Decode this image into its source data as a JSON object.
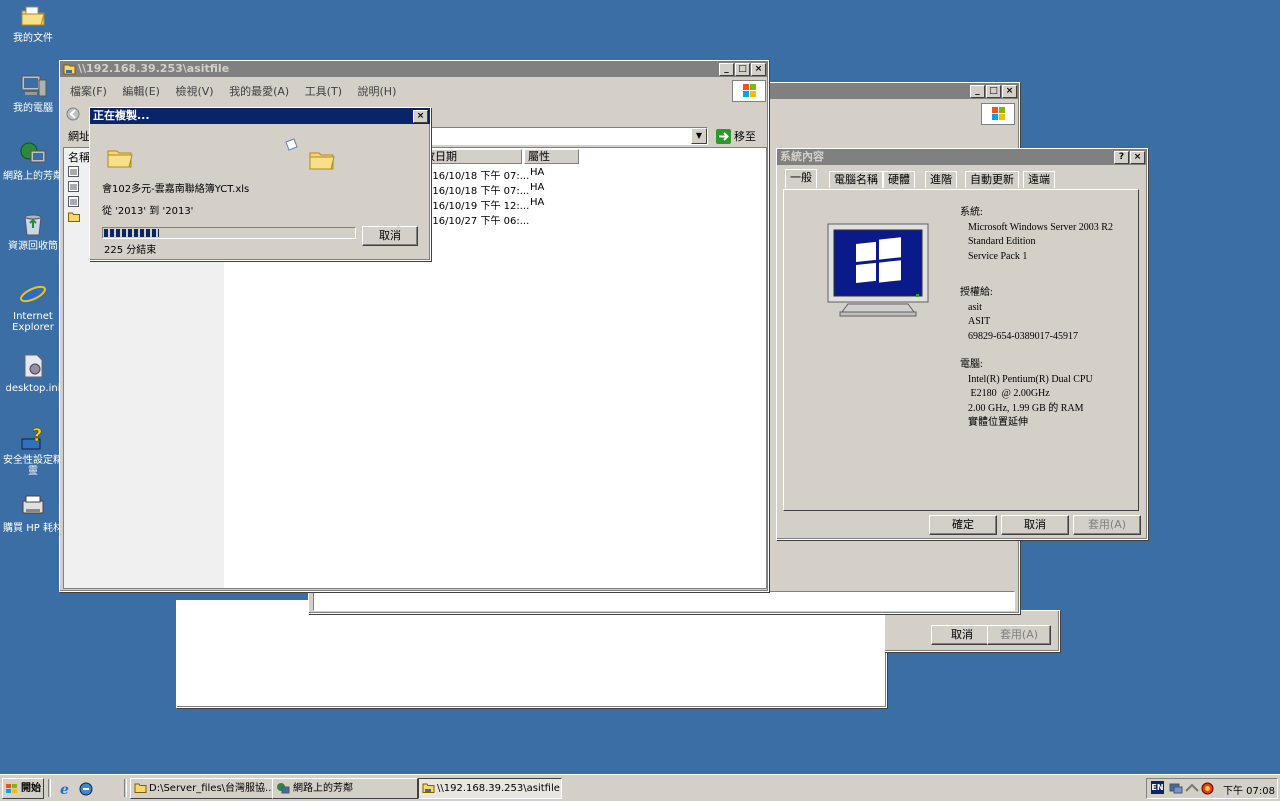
{
  "desktop": {
    "icons": [
      {
        "label": "我的文件",
        "icon": "folder-icon"
      },
      {
        "label": "我的電腦",
        "icon": "computer-icon"
      },
      {
        "label": "網路上的芳鄰",
        "icon": "network-icon"
      },
      {
        "label": "資源回收筒",
        "icon": "recycle-bin-icon"
      },
      {
        "label": "Internet Explorer",
        "icon": "ie-icon"
      },
      {
        "label": "desktop.ini",
        "icon": "ini-file-icon"
      },
      {
        "label": "安全性設定精靈",
        "icon": "security-wizard-icon"
      },
      {
        "label": "購買 HP 耗材",
        "icon": "hp-icon"
      }
    ]
  },
  "explorer": {
    "title": "\\\\192.168.39.253\\asitfile",
    "menu": [
      "檔案(F)",
      "編輯(E)",
      "檢視(V)",
      "我的最愛(A)",
      "工具(T)",
      "說明(H)"
    ],
    "address_label": "網址",
    "go_label": "移至",
    "columns": [
      "名稱",
      "修改日期",
      "屬性"
    ],
    "rows": [
      {
        "date": "016/10/18 下午 07:...",
        "attr": "HA"
      },
      {
        "date": "016/10/18 下午 07:...",
        "attr": "HA"
      },
      {
        "date": "016/10/19 下午 12:...",
        "attr": "HA"
      },
      {
        "date": "016/10/27 下午 06:...",
        "attr": ""
      }
    ]
  },
  "copy_dialog": {
    "title": "正在複製...",
    "filename": "會102多元-雲嘉南聯絡簿YCT.xls",
    "from_to": "從 '2013' 到 '2013'",
    "progress": 0.22,
    "time_left": "225 分結束",
    "cancel_label": "取消"
  },
  "sysprops": {
    "title": "系統內容",
    "tabs": [
      "一般",
      "電腦名稱",
      "硬體",
      "進階",
      "自動更新",
      "遠端"
    ],
    "system_label": "系統:",
    "system_lines": [
      "Microsoft Windows Server 2003 R2",
      "Standard Edition",
      "Service Pack 1"
    ],
    "registered_label": "授權給:",
    "registered_lines": [
      "asit",
      "ASIT",
      "69829-654-0389017-45917"
    ],
    "computer_label": "電腦:",
    "computer_lines": [
      "Intel(R) Pentium(R) Dual  CPU",
      " E2180  @ 2.00GHz",
      "2.00 GHz, 1.99 GB 的 RAM",
      "實體位置延伸"
    ],
    "ok_label": "確定",
    "cancel_label": "取消",
    "apply_label": "套用(A)"
  },
  "back_dialog": {
    "cancel_label": "取消",
    "apply_label": "套用(A)"
  },
  "taskbar": {
    "start_label": "開始",
    "tasks": [
      {
        "label": "D:\\Server_files\\台灣服協..."
      },
      {
        "label": "網路上的芳鄰"
      },
      {
        "label": "\\\\192.168.39.253\\asitfile"
      }
    ],
    "lang": "EN",
    "clock": "下午 07:08"
  }
}
